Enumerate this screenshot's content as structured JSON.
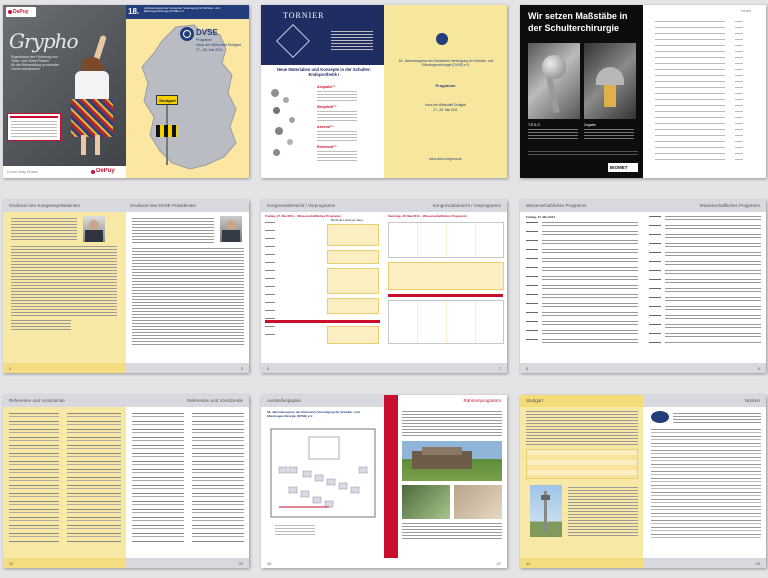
{
  "cover1": {
    "brand": "DePuy",
    "chalk_title": "Grypho",
    "chalk_lines": [
      "Ergebnisse der Fixierung von",
      "Titan- und Stahl-Platten",
      "für die Behandlung proximaler",
      "Humerusfrakturen"
    ],
    "board_sticker": "Fixieren Sie Ihre Vorteile\nbei DePuy",
    "footer_left": "Know Way Ahead",
    "footer_brand": "DePuy",
    "edition": "18.",
    "header_text": "Jahreskongress der Deutschen Vereinigung für Schulter- und Ellenbogenchirurgie (DVSE) e.V.",
    "dvse": "DVSE",
    "program_label": "Programm",
    "venue": "Haus der Wirtschaft Stuttgart",
    "dates": "27.–28. Mai 2011",
    "sign": "Stuttgart"
  },
  "cover2": {
    "brand": "TORNIER",
    "banner": "Neue Materialien und Konzepte in der Schulter-Endoprothetik !",
    "products": [
      "Aequalis™",
      "Simpliciti™",
      "Ascend™",
      "Reversed™"
    ],
    "right_heading": "18. Jahreskongress der Deutschen Vereinigung für Schulter- und Ellenbogenchirurgie (DVSE) e.V.",
    "program": "Programm",
    "venue": "Haus der Wirtschaft Stuttgart",
    "dates": "27.–28. Mai 2011",
    "url": "www.dvse-kongress.de"
  },
  "cover3": {
    "headline_1": "Wir setzen Maßstäbe in",
    "headline_2": "der Schulterchirurgie",
    "product_a": "T.E.S.S.",
    "product_b": "Zugabe",
    "brand": "BIOMET",
    "toc_title": "Inhalt"
  },
  "spread4": {
    "title_left": "Grußwort des Kongresspräsidenten",
    "title_right": "Grußwort des DVSE Präsidenten",
    "page_left": "4",
    "page_right": "5"
  },
  "spread5": {
    "title_left": "Kongressübersicht / Vorprogramm",
    "title_right": "Kongressübersicht / Vorprogramm",
    "day_left": "Freitag, 27. Mai 2011 – Wissenschaftliches Programm",
    "day_right": "Samstag, 28. Mai 2011 – Wissenschaftliches Programm",
    "hall": "Berthold-Leibinger-Saal",
    "page_left": "6",
    "page_right": "7"
  },
  "spread6": {
    "title_left": "Wissenschaftliches Programm",
    "title_right": "Wissenschaftliches Programm",
    "day": "Freitag, 27. Mai 2011",
    "page_left": "8",
    "page_right": "9"
  },
  "spread7": {
    "title_left": "Referenten und Vorsitzende",
    "title_right": "Referenten und Vorsitzende",
    "page_left": "32",
    "page_right": "33"
  },
  "spread8": {
    "title_left": "Ausstellungsplan",
    "title_right": "Rahmenprogramm",
    "heading": "18. Jahreskongress der Deutschen Vereinigung für Schulter- und Ellenbogenchirurgie (DVSE) e.V.",
    "page_left": "36",
    "page_right": "37"
  },
  "spread9": {
    "title_left": "Stuttgart",
    "title_right": "Notizen",
    "page_left": "44",
    "page_right": "45"
  }
}
